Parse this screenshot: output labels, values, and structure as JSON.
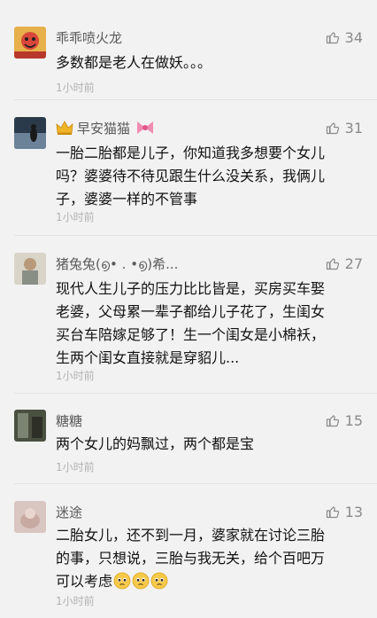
{
  "comments": [
    {
      "name": "乖乖喷火龙",
      "likes": "34",
      "text": "多数都是老人在做妖。。。",
      "time": "1小时前"
    },
    {
      "name": "早安猫猫",
      "likes": "31",
      "text": "一胎二胎都是儿子，你知道我多想要个女儿\n吗？婆婆待不待见跟生什么没关系，我俩儿\n子，婆婆一样的不管事",
      "time": "1小时前"
    },
    {
      "name": "猪兔兔(൭• . •൭)希...",
      "likes": "27",
      "text": "现代人生儿子的压力比比皆是，买房买车娶\n老婆，父母累一辈子都给儿子花了，生闺女\n买台车陪嫁足够了！生一个闺女是小棉袄，\n生两个闺女直接就是穿貂儿...",
      "time": "1小时前"
    },
    {
      "name": "糖糖",
      "likes": "15",
      "text": "两个女儿的妈飘过，两个都是宝",
      "time": "1小时前"
    },
    {
      "name": "迷途",
      "likes": "13",
      "text": "二胎女儿，还不到一月，婆家就在讨论三胎\n的事，只想说，三胎与我无关，给个百吧万\n可以考虑",
      "time": "1小时前"
    }
  ],
  "icons": {
    "like": "thumbs-up-icon",
    "crown": "crown-icon",
    "bow": "bow-icon",
    "emoji": "pleading-face-emoji"
  },
  "colors": {
    "background": "#f2f2f2",
    "name": "#5a5a5a",
    "time": "#b2b2b2",
    "like": "#8a8a8a"
  }
}
